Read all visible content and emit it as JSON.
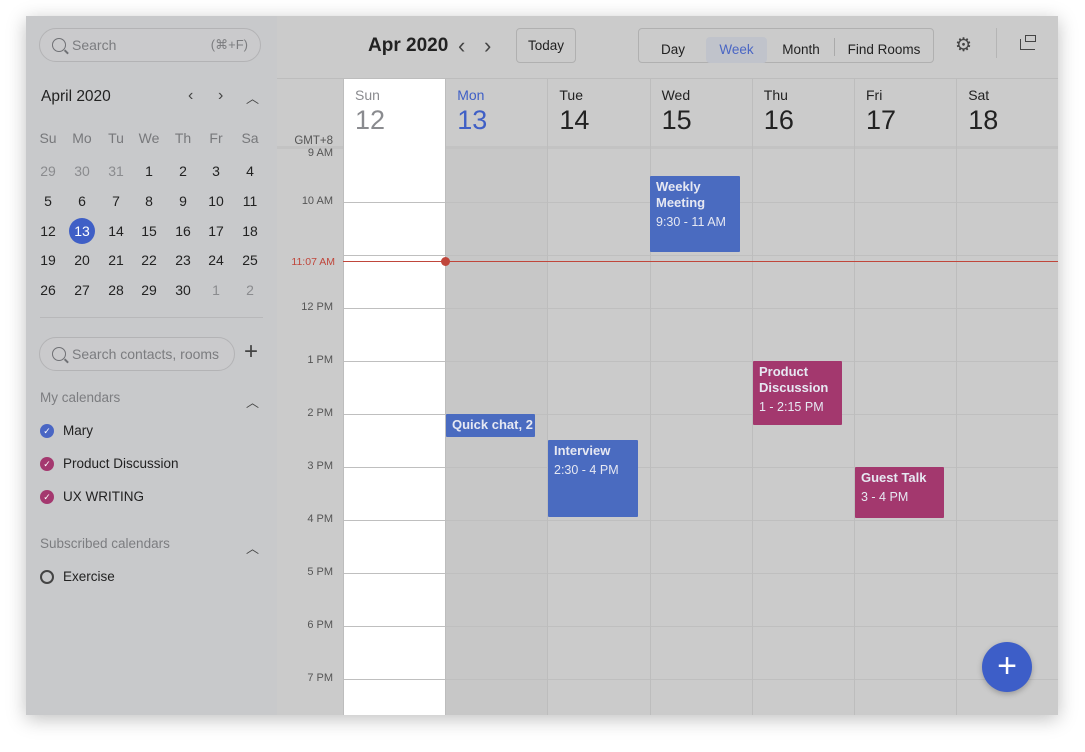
{
  "sidebar": {
    "search_placeholder": "Search",
    "search_shortcut": "(⌘+F)",
    "mini_month": "April 2020",
    "weekdays": [
      "Su",
      "Mo",
      "Tu",
      "We",
      "Th",
      "Fr",
      "Sa"
    ],
    "weeks": [
      [
        29,
        30,
        31,
        1,
        2,
        3,
        4
      ],
      [
        5,
        6,
        7,
        8,
        9,
        10,
        11
      ],
      [
        12,
        13,
        14,
        15,
        16,
        17,
        18
      ],
      [
        19,
        20,
        21,
        22,
        23,
        24,
        25
      ],
      [
        26,
        27,
        28,
        29,
        30,
        1,
        2
      ]
    ],
    "today": 13,
    "contact_search_placeholder": "Search contacts, rooms",
    "my_calendars_label": "My calendars",
    "my_calendars": [
      {
        "name": "Mary",
        "color": "#4a66c4",
        "checked": true
      },
      {
        "name": "Product Discussion",
        "color": "#a4386f",
        "checked": true
      },
      {
        "name": "UX WRITING",
        "color": "#a4386f",
        "checked": true
      }
    ],
    "subscribed_label": "Subscribed calendars",
    "subscribed": [
      {
        "name": "Exercise",
        "checked": false
      }
    ]
  },
  "header": {
    "title": "Apr 2020",
    "today_label": "Today",
    "views": [
      "Day",
      "Week",
      "Month",
      "Find Rooms"
    ],
    "active_view": "Week"
  },
  "week": {
    "timezone": "GMT+8",
    "days": [
      {
        "name": "Sun",
        "date": "12"
      },
      {
        "name": "Mon",
        "date": "13"
      },
      {
        "name": "Tue",
        "date": "14"
      },
      {
        "name": "Wed",
        "date": "15"
      },
      {
        "name": "Thu",
        "date": "16"
      },
      {
        "name": "Fri",
        "date": "17"
      },
      {
        "name": "Sat",
        "date": "18"
      }
    ],
    "hours": [
      "9 AM",
      "10 AM",
      "11 AM",
      "12 PM",
      "1 PM",
      "2 PM",
      "3 PM",
      "4 PM",
      "5 PM",
      "6 PM",
      "7 PM"
    ],
    "now_label": "11:07 AM",
    "events": [
      {
        "title": "Weekly Meeting",
        "time": "9:30 - 11 AM",
        "color": "#4a6bc0"
      },
      {
        "title": "Quick chat, 2",
        "time": "",
        "color": "#4a6bc0"
      },
      {
        "title": "Interview",
        "time": "2:30 - 4 PM",
        "color": "#4a6bc0"
      },
      {
        "title": "Product Discussion",
        "time": "1 - 2:15 PM",
        "color": "#a3386e"
      },
      {
        "title": "Guest Talk",
        "time": "3 - 4 PM",
        "color": "#a3386e"
      }
    ]
  },
  "colors": {
    "accent": "#3f5fc6",
    "now_line": "#c0463b"
  }
}
